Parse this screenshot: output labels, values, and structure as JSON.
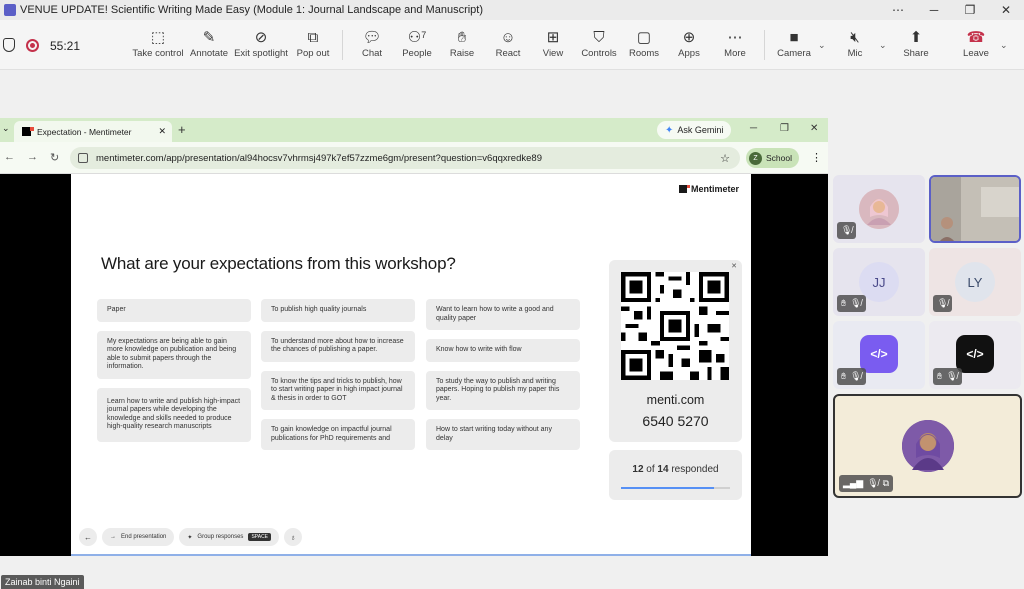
{
  "window": {
    "title": "VENUE UPDATE! Scientific Writing Made Easy (Module 1: Journal Landscape and Manuscript)"
  },
  "meeting": {
    "timer": "55:21",
    "toolbar": [
      {
        "label": "Take control",
        "icon": "take-control-icon"
      },
      {
        "label": "Annotate",
        "icon": "annotate-icon"
      },
      {
        "label": "Exit spotlight",
        "icon": "exit-spotlight-icon"
      },
      {
        "label": "Pop out",
        "icon": "pop-out-icon"
      },
      {
        "label": "Chat",
        "icon": "chat-icon"
      },
      {
        "label": "People",
        "icon": "people-icon",
        "count": "7"
      },
      {
        "label": "Raise",
        "icon": "raise-hand-icon"
      },
      {
        "label": "React",
        "icon": "react-icon"
      },
      {
        "label": "View",
        "icon": "view-icon"
      },
      {
        "label": "Controls",
        "icon": "controls-icon"
      },
      {
        "label": "Rooms",
        "icon": "rooms-icon"
      },
      {
        "label": "Apps",
        "icon": "apps-icon"
      },
      {
        "label": "More",
        "icon": "more-icon"
      },
      {
        "label": "Camera",
        "icon": "camera-off-icon"
      },
      {
        "label": "Mic",
        "icon": "mic-off-icon"
      },
      {
        "label": "Share",
        "icon": "share-icon"
      },
      {
        "label": "Leave",
        "icon": "leave-icon",
        "color": "#c4314b"
      }
    ]
  },
  "browser": {
    "tab_title": "Expectation - Mentimeter",
    "ask_gemini": "Ask Gemini",
    "url": "mentimeter.com/app/presentation/al94hocsv7vhrmsj497k7ef57zzme6gm/present?question=v6qqxredke89",
    "profile_initial": "Z",
    "profile_label": "School"
  },
  "slide": {
    "brand": "Mentimeter",
    "question": "What are your expectations from this workshop?",
    "columns": [
      [
        "Paper",
        "My expectations are being able to gain more knowledge on publication and being able to submit papers through the information.",
        "Learn how to write and publish high-impact journal papers while developing the knowledge and skills needed to produce high-quality research manuscripts"
      ],
      [
        "To publish high quality journals",
        "To understand more about how to increase the chances of publishing a paper.",
        "To know the tips and tricks to publish, how to start writing paper in high impact journal & thesis in order to GOT",
        "To gain knowledge on impactful journal publications for PhD requirements and"
      ],
      [
        "Want to learn how to write a good and quality paper",
        "Know how to write with flow",
        "To study the way to publish and writing papers. Hoping to publish my paper this year.",
        "How to start writing today without any delay"
      ]
    ],
    "join_url": "menti.com",
    "join_code": "6540 5270",
    "responded": "12",
    "total": "14",
    "of_label": "of",
    "responded_label": "responded",
    "progress_fraction": 0.857,
    "footer": {
      "end_label": "End presentation",
      "group_label": "Group responses",
      "group_key": "SPACE"
    }
  },
  "presenter_name": "Zainab binti Ngaini",
  "participants": [
    {
      "type": "photo",
      "initials": ""
    },
    {
      "type": "video",
      "initials": ""
    },
    {
      "type": "initials",
      "initials": "JJ"
    },
    {
      "type": "initials",
      "initials": "LY"
    },
    {
      "type": "app",
      "initials": "</>",
      "color": "#7a5cf0"
    },
    {
      "type": "app",
      "initials": "</>",
      "color": "#111111"
    }
  ]
}
